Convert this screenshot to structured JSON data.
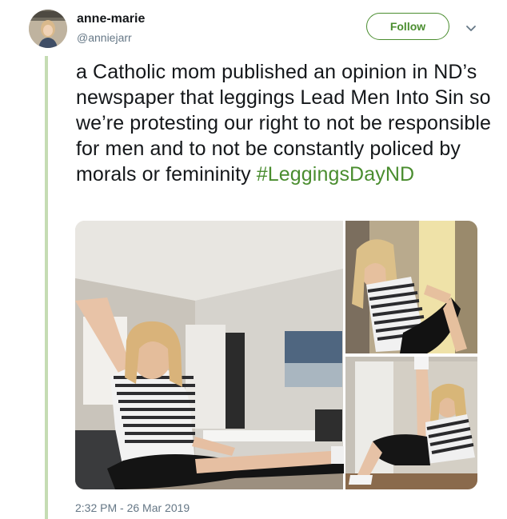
{
  "tweet": {
    "author": {
      "display_name": "anne-marie",
      "handle": "@anniejarr",
      "avatar_icon": "user-avatar"
    },
    "follow_label": "Follow",
    "caret_icon": "chevron-down-icon",
    "text_parts": [
      "a Catholic mom published an opinion in ND’s newspaper that leggings Lead Men Into Sin so we’re protesting our right to not be responsible for men and to not be constantly policed by morals or femininity ",
      "#LeggingsDayND"
    ],
    "timestamp": "2:32 PM - 26 Mar 2019",
    "media": [
      {
        "name": "photo-living-room-stretch"
      },
      {
        "name": "photo-wall-stretch"
      },
      {
        "name": "photo-door-leg-raise"
      }
    ]
  },
  "colors": {
    "accent": "#4a8d2f",
    "thread_line": "#c5dcb3",
    "secondary_text": "#657786",
    "primary_text": "#14171a"
  }
}
